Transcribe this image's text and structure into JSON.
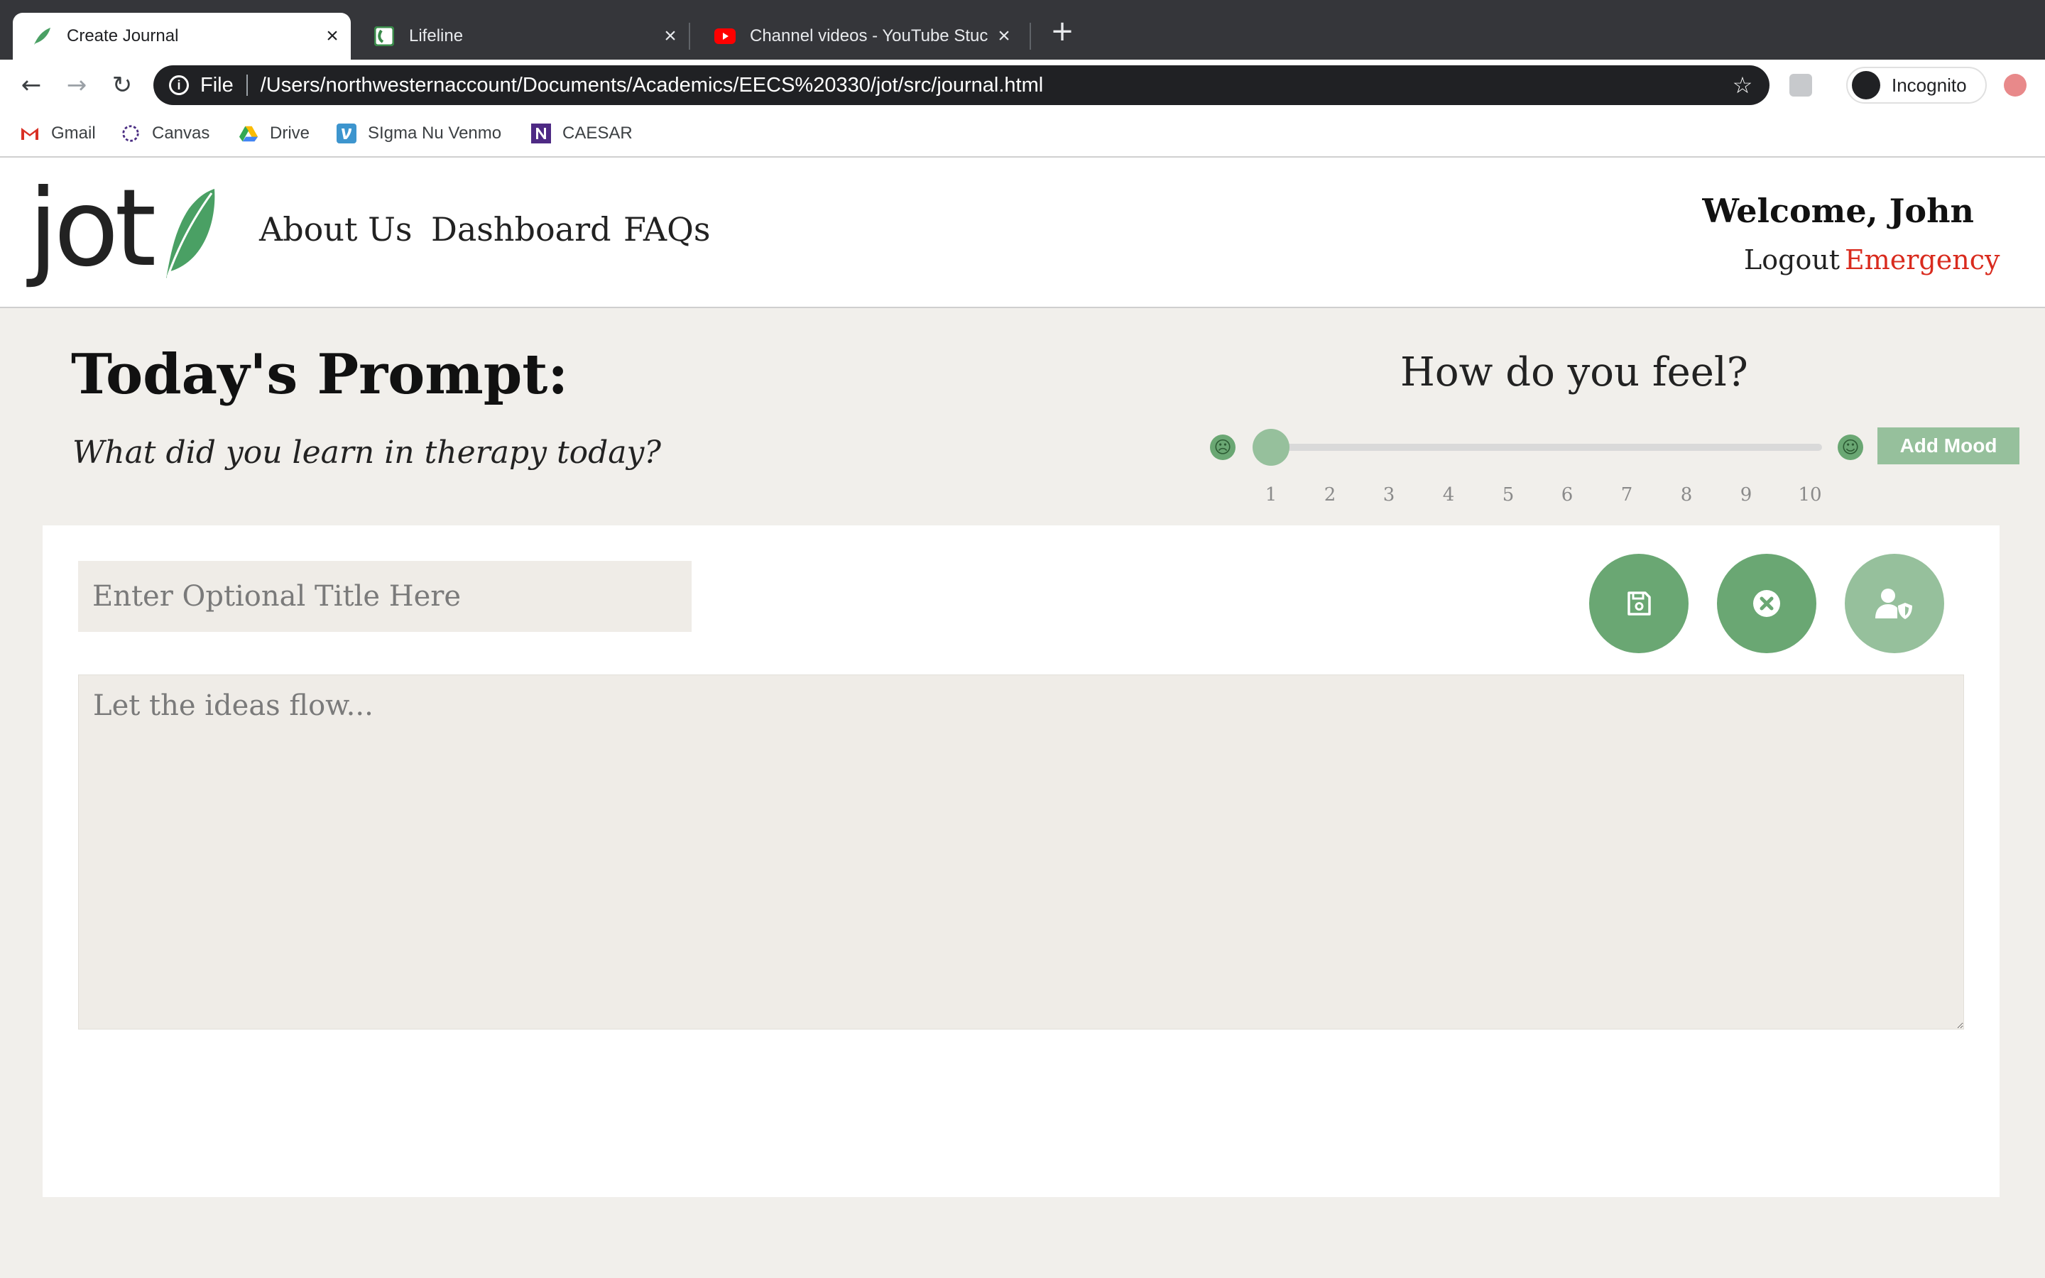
{
  "browser": {
    "tabs": [
      {
        "title": "Create Journal",
        "active": true
      },
      {
        "title": "Lifeline",
        "active": false
      },
      {
        "title": "Channel videos - YouTube Stuc",
        "active": false
      }
    ],
    "address": {
      "scheme_label": "File",
      "url": "/Users/northwesternaccount/Documents/Academics/EECS%20330/jot/src/journal.html"
    },
    "profile_label": "Incognito",
    "bookmarks": [
      {
        "label": "Gmail",
        "icon": "gmail-icon"
      },
      {
        "label": "Canvas",
        "icon": "canvas-icon"
      },
      {
        "label": "Drive",
        "icon": "drive-icon"
      },
      {
        "label": "SIgma Nu Venmo",
        "icon": "venmo-icon"
      },
      {
        "label": "CAESAR",
        "icon": "northwestern-icon"
      }
    ]
  },
  "header": {
    "logo_text": "jot",
    "nav": [
      "About Us",
      "Dashboard",
      "FAQs"
    ],
    "welcome": "Welcome, John",
    "logout": "Logout",
    "emergency": "Emergency"
  },
  "prompt": {
    "heading": "Today's Prompt:",
    "question": "What did you learn in therapy today?"
  },
  "mood": {
    "heading": "How do you feel?",
    "scale": [
      "1",
      "2",
      "3",
      "4",
      "5",
      "6",
      "7",
      "8",
      "9",
      "10"
    ],
    "value": 1,
    "min": 1,
    "max": 10,
    "add_label": "Add Mood"
  },
  "editor": {
    "title_placeholder": "Enter Optional Title Here",
    "body_placeholder": "Let the ideas flow..."
  },
  "colors": {
    "accent_green": "#6aa773",
    "accent_green_light": "#96c09c",
    "emergency_red": "#d92b1e",
    "page_bg": "#f1efeb"
  }
}
